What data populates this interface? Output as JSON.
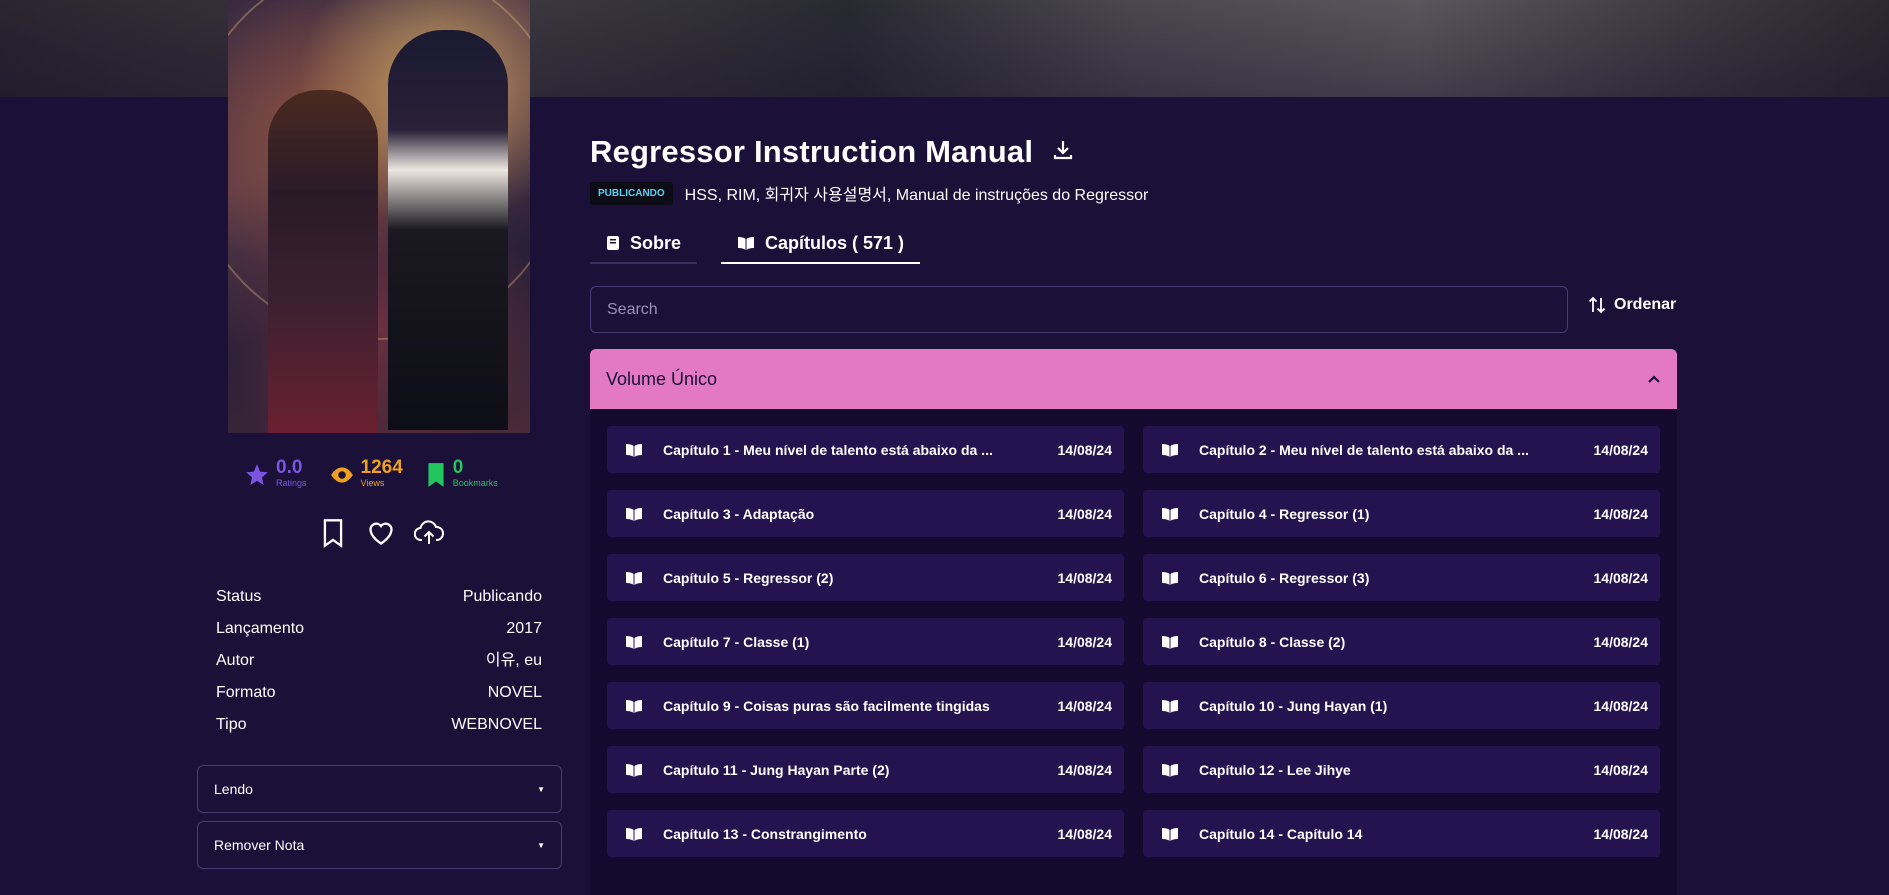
{
  "manga": {
    "title": "Regressor Instruction Manual",
    "status_badge": "PUBLICANDO",
    "alt_names": "HSS, RIM, 회귀자 사용설명서, Manual de instruções do Regressor"
  },
  "stats": [
    {
      "value": "0.0",
      "label": "Ratings",
      "color": "#7b55e0",
      "icon": "star-icon"
    },
    {
      "value": "1264",
      "label": "Views",
      "color": "#f0a020",
      "icon": "eye-icon"
    },
    {
      "value": "0",
      "label": "Bookmarks",
      "color": "#22c55e",
      "icon": "bookmark-icon"
    }
  ],
  "info": [
    {
      "label": "Status",
      "value": "Publicando"
    },
    {
      "label": "Lançamento",
      "value": "2017"
    },
    {
      "label": "Autor",
      "value": "이유, eu"
    },
    {
      "label": "Formato",
      "value": "NOVEL"
    },
    {
      "label": "Tipo",
      "value": "WEBNOVEL"
    }
  ],
  "selects": {
    "reading": "Lendo",
    "rating": "Remover Nota"
  },
  "tabs": [
    {
      "label": "Sobre"
    },
    {
      "label": "Capítulos ( 571 )"
    }
  ],
  "search": {
    "placeholder": "Search"
  },
  "sort_label": "Ordenar",
  "volume": {
    "title": "Volume Único",
    "chapters": [
      {
        "title": "Capítulo 1 - Meu nível de talento está abaixo da ...",
        "date": "14/08/24"
      },
      {
        "title": "Capítulo 2 - Meu nível de talento está abaixo da ...",
        "date": "14/08/24"
      },
      {
        "title": "Capítulo 3 - Adaptação",
        "date": "14/08/24"
      },
      {
        "title": "Capítulo 4 - Regressor (1)",
        "date": "14/08/24"
      },
      {
        "title": "Capítulo 5 - Regressor (2)",
        "date": "14/08/24"
      },
      {
        "title": "Capítulo 6 - Regressor (3)",
        "date": "14/08/24"
      },
      {
        "title": "Capítulo 7 - Classe (1)",
        "date": "14/08/24"
      },
      {
        "title": "Capítulo 8 - Classe (2)",
        "date": "14/08/24"
      },
      {
        "title": "Capítulo 9 - Coisas puras são facilmente tingidas",
        "date": "14/08/24"
      },
      {
        "title": "Capítulo 10 - Jung Hayan (1)",
        "date": "14/08/24"
      },
      {
        "title": "Capítulo 11 - Jung Hayan Parte (2)",
        "date": "14/08/24"
      },
      {
        "title": "Capítulo 12 - Lee Jihye",
        "date": "14/08/24"
      },
      {
        "title": "Capítulo 13 - Constrangimento",
        "date": "14/08/24"
      },
      {
        "title": "Capítulo 14 - Capítulo 14",
        "date": "14/08/24"
      }
    ]
  },
  "colors": {
    "background": "#1a1038",
    "accent_volume": "#e479c3",
    "chapter_bg": "#24134f",
    "badge_text": "#5cd0f0"
  }
}
